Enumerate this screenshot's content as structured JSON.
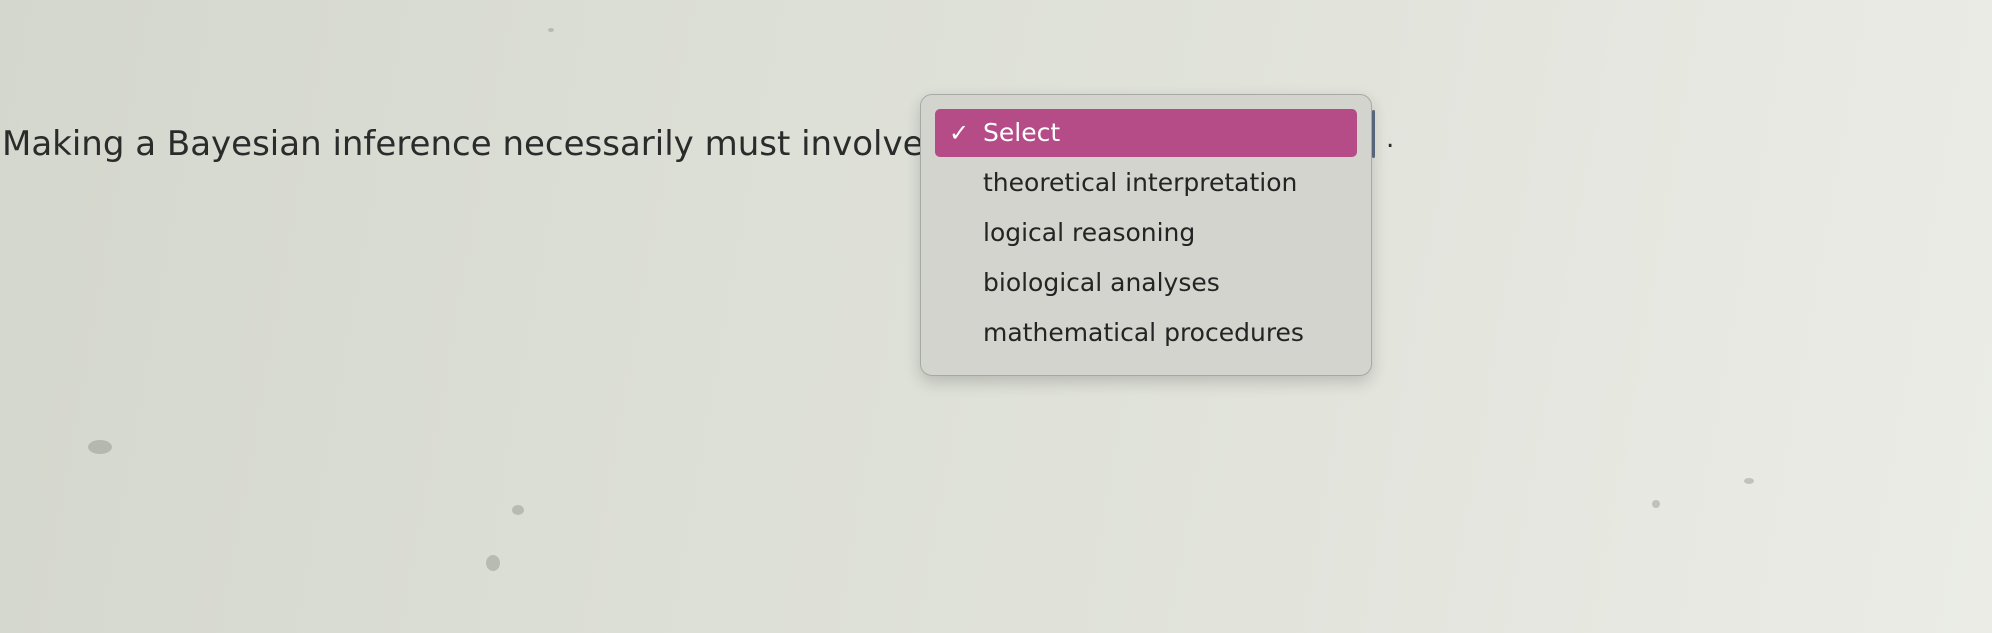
{
  "question": {
    "text": "Making a Bayesian inference necessarily must involve",
    "trailing_punctuation": "."
  },
  "dropdown": {
    "selected_value": "Select",
    "checkmark": "✓",
    "options": [
      "Select",
      "theoretical interpretation",
      "logical reasoning",
      "biological analyses",
      "mathematical procedures"
    ],
    "highlight_color": "#b54c88"
  }
}
